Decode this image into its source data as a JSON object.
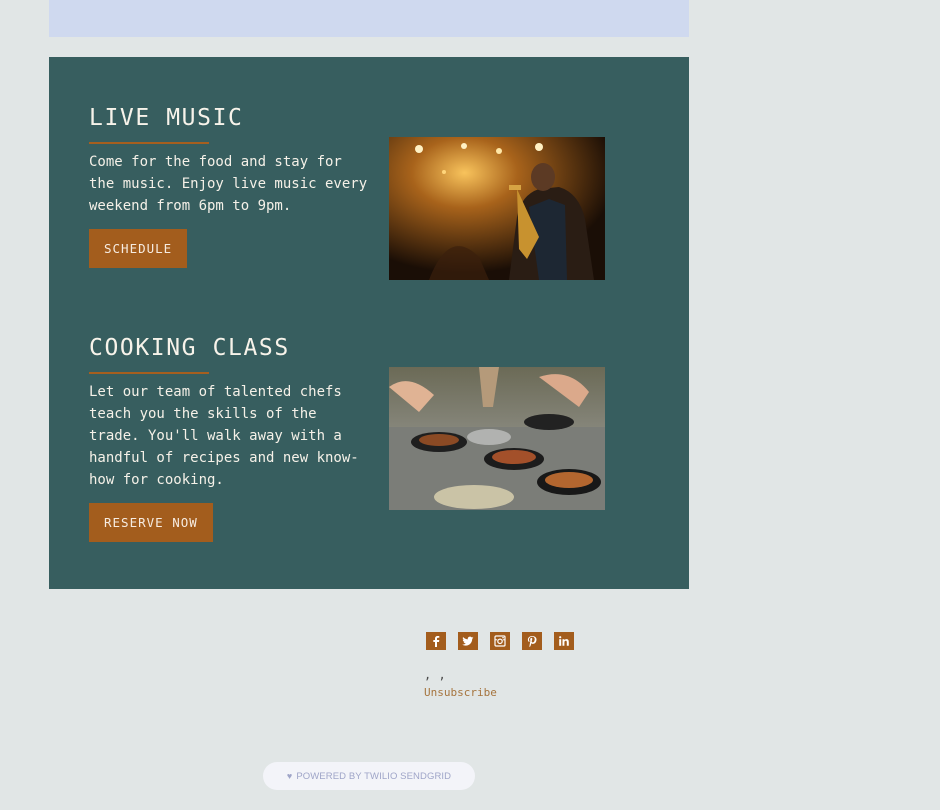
{
  "sections": [
    {
      "title": "LIVE MUSIC",
      "description": "Come for the food and stay for the music. Enjoy live music every weekend from 6pm to 9pm.",
      "button_label": "SCHEDULE",
      "image_alt": "saxophone player on stage"
    },
    {
      "title": "COOKING CLASS",
      "description": "Let our team of talented chefs teach you the skills of the trade. You'll walk away with a handful of recipes and new know-how for cooking.",
      "button_label": "RESERVE NOW",
      "image_alt": "chefs cooking in frying pans"
    }
  ],
  "footer": {
    "social": [
      {
        "icon": "facebook-icon",
        "glyph": "f"
      },
      {
        "icon": "twitter-icon",
        "glyph": "t"
      },
      {
        "icon": "instagram-icon",
        "glyph": "ig"
      },
      {
        "icon": "pinterest-icon",
        "glyph": "P"
      },
      {
        "icon": "linkedin-icon",
        "glyph": "in"
      }
    ],
    "address": ", ,",
    "unsubscribe_label": "Unsubscribe",
    "powered_by": "POWERED BY TWILIO SENDGRID"
  },
  "colors": {
    "card": "#375e5f",
    "accent": "#a35d1d",
    "page": "#e1e6e6"
  }
}
